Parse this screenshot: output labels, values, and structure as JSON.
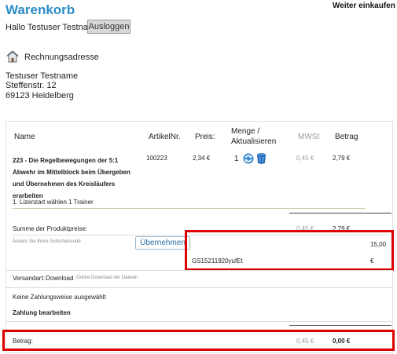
{
  "header": {
    "title": "Warenkorb",
    "continue_shopping": "Weiter einkaufen",
    "greeting": "Hallo Testuser Testname",
    "logout_label": "Ausloggen"
  },
  "billing": {
    "heading": "Rechnungsadresse",
    "name": "Testuser Testname",
    "street": "Steffenstr. 12",
    "city": "69123 Heidelberg"
  },
  "table": {
    "col_name": "Name",
    "col_article": "ArtikelNr.",
    "col_price": "Preis:",
    "col_qty_line1": "Menge /",
    "col_qty_line2": "Aktualisieren",
    "col_vat": "MWSt",
    "col_amount": "Betrag"
  },
  "item": {
    "title": "223 - Die Regelbewegungen der 5:1 Abwehr im Mittelblock beim Übergeben und Übernehmen des Kreisläufers erarbeiten",
    "subtitle": "1. Lizenzart wählen 1 Trainer",
    "article_no": "100223",
    "price": "2,34 €",
    "quantity": "1",
    "vat": "0,45 €",
    "amount": "2,79 €"
  },
  "subtotal": {
    "label": "Summe der Produktpreise:",
    "vat": "0,45 €",
    "amount": "2,79 €"
  },
  "coupon": {
    "label": "Ändern Sie Ihren Gutscheincode",
    "apply_label": "Übernehmen",
    "code": "GS15211920yufEt",
    "value": "15,00",
    "currency": "€"
  },
  "shipping": {
    "label": "Versandart:",
    "method": "Download",
    "note": "Online Download der Dateien"
  },
  "payment": {
    "none_selected": "Keine Zahlungsweise ausgewählt",
    "edit_label": "Zahlung bearbeiten"
  },
  "total": {
    "label": "Betrag:",
    "vat": "0,45 €",
    "amount": "0,00 €"
  },
  "colors": {
    "title_blue": "#2a8ec7",
    "highlight_red": "#dd0000"
  }
}
